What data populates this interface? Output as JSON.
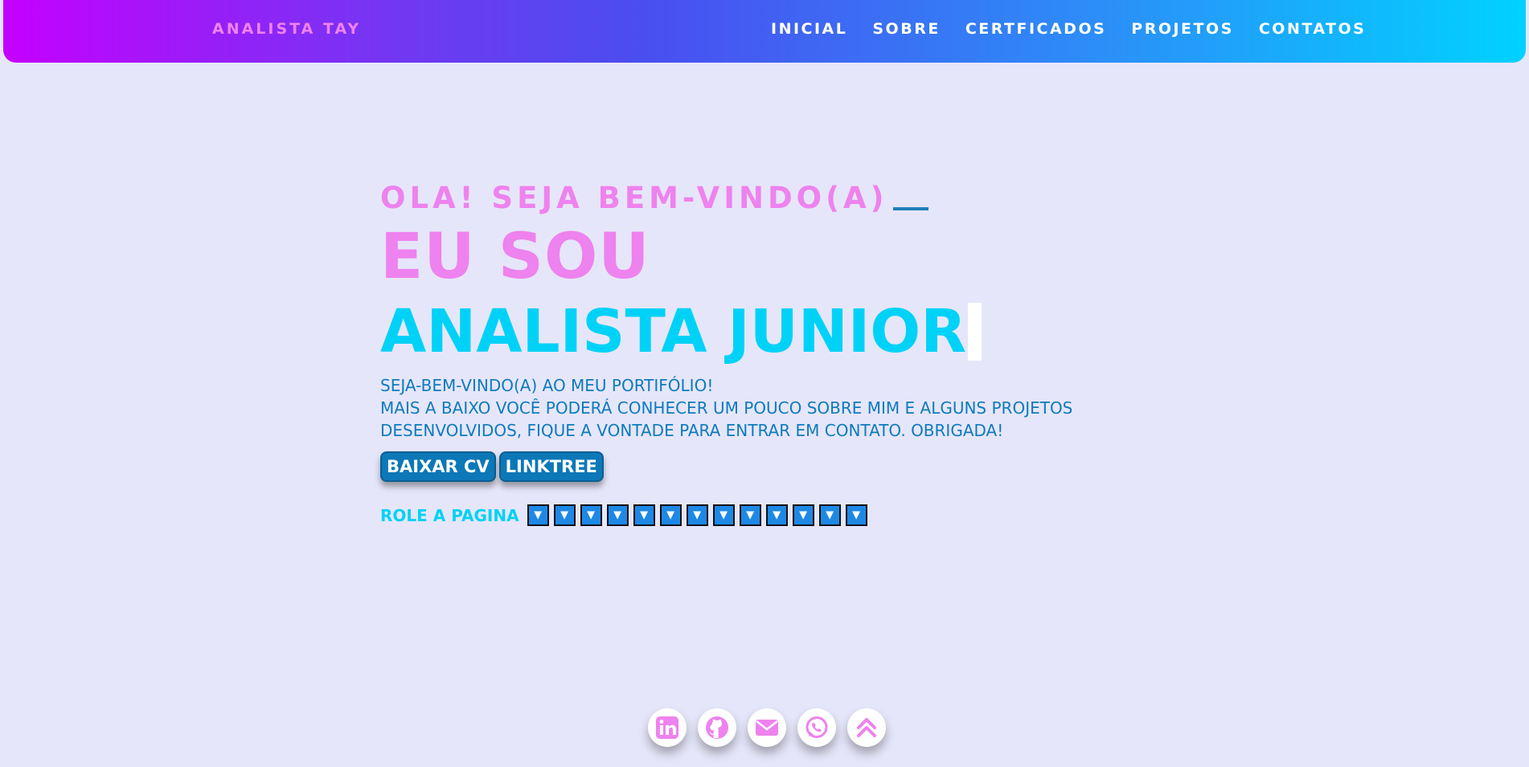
{
  "nav": {
    "brand": "ANALISTA TAY",
    "links": [
      "INICIAL",
      "SOBRE",
      "CERTFICADOS",
      "PROJETOS",
      "CONTATOS"
    ]
  },
  "hero": {
    "greeting": "OLA! SEJA BEM-VINDO(A)",
    "intro": "EU SOU",
    "role": "ANALISTA JUNIOR",
    "description_lines": [
      "SEJA-BEM-VINDO(A) AO MEU PORTIFÓLIO!",
      "MAIS A BAIXO VOCÊ PODERÁ CONHECER UM POUCO SOBRE MIM E ALGUNS PROJETOS",
      "DESENVOLVIDOS, FIQUE A VONTADE PARA ENTRAR EM CONTATO. OBRIGADA!"
    ],
    "buttons": {
      "cv": "BAIXAR CV",
      "linktree": "LINKTREE"
    },
    "scroll_label": "ROLE A PAGINA",
    "scroll_arrow": "▼"
  },
  "socials": [
    "linkedin-icon",
    "github-icon",
    "mail-icon",
    "whatsapp-icon",
    "chevrons-up-icon"
  ],
  "colors": {
    "pink": "#ee82ee",
    "cyan": "#00d2f7",
    "blue": "#0d78b8",
    "background": "#e6e6fa"
  }
}
